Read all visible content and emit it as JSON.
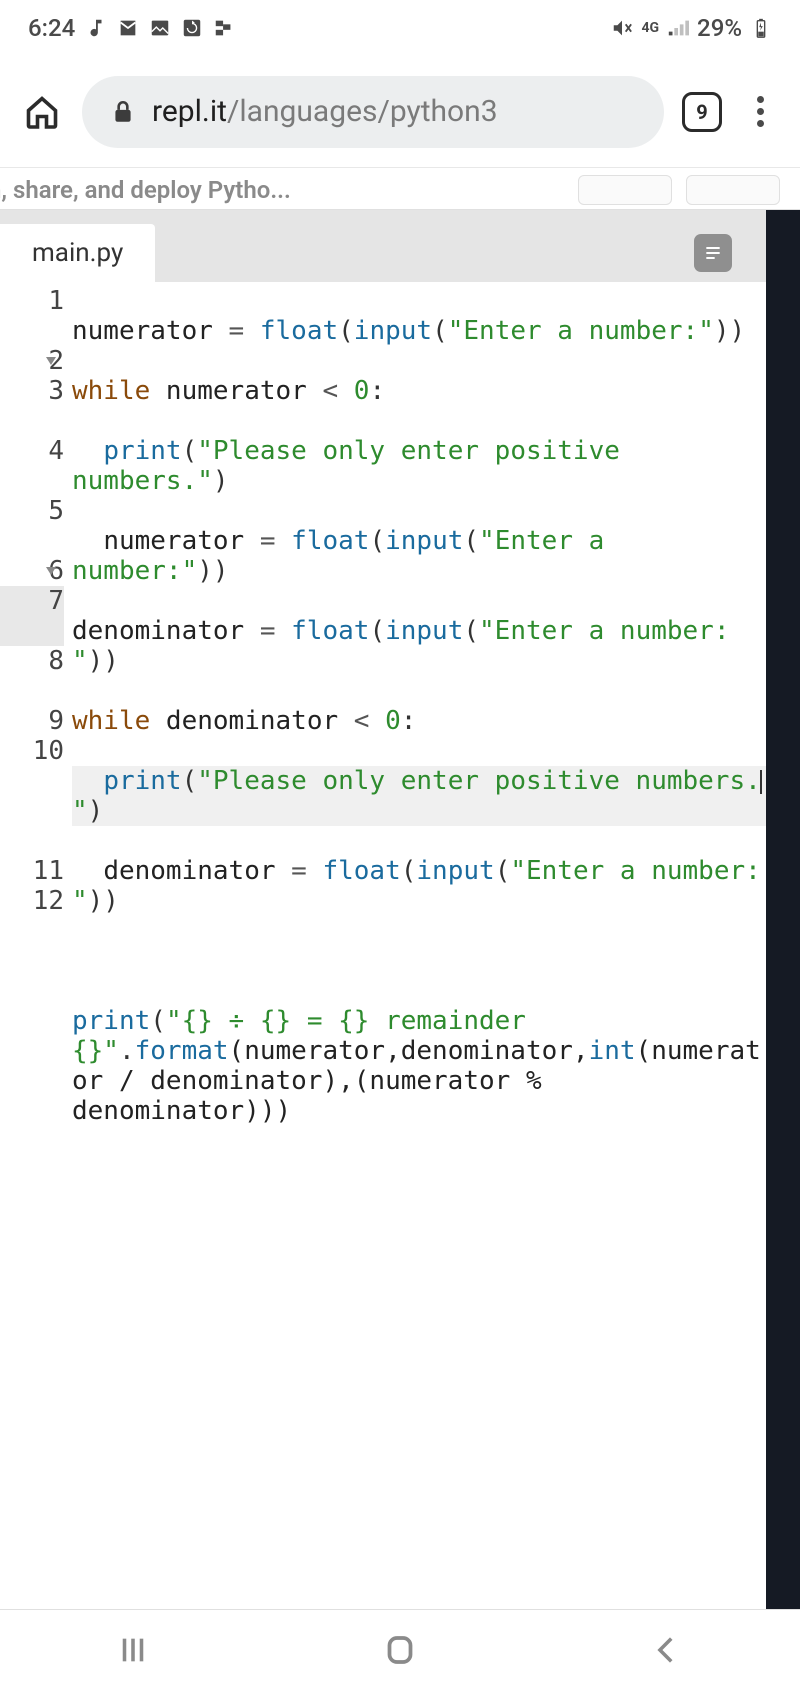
{
  "status": {
    "time": "6:24",
    "network_label": "4G",
    "battery_percent": "29%"
  },
  "browser": {
    "url_domain": "repl.it",
    "url_path": "/languages/python3",
    "tab_count": "9"
  },
  "banner": {
    "truncated_text": "n, share, and deploy Pytho..."
  },
  "editor": {
    "filename": "main.py",
    "line_numbers": [
      "1",
      "2",
      "3",
      "4",
      "5",
      "6",
      "7",
      "8",
      "9",
      "10",
      "11",
      "12"
    ],
    "highlighted_line": 7,
    "fold_lines": [
      2,
      6
    ],
    "code": {
      "l1": {
        "a": "numerator ",
        "b": "=",
        "c": " ",
        "d": "float",
        "e": "(",
        "f": "input",
        "g": "(",
        "h": "\"Enter a number:\"",
        "i": "))"
      },
      "l2": {
        "a": "while",
        "b": " numerator ",
        "c": "<",
        "d": " ",
        "e": "0",
        "f": ":"
      },
      "l3": {
        "a": "  ",
        "b": "print",
        "c": "(",
        "d": "\"Please only enter positive numbers.\"",
        "e": ")"
      },
      "l4": {
        "a": "  numerator ",
        "b": "=",
        "c": " ",
        "d": "float",
        "e": "(",
        "f": "input",
        "g": "(",
        "h": "\"Enter a number:\"",
        "i": "))"
      },
      "l5": {
        "a": "denominator ",
        "b": "=",
        "c": " ",
        "d": "float",
        "e": "(",
        "f": "input",
        "g": "(",
        "h": "\"Enter a number: \"",
        "i": "))"
      },
      "l6": {
        "a": "while",
        "b": " denominator ",
        "c": "<",
        "d": " ",
        "e": "0",
        "f": ":"
      },
      "l7": {
        "a": "  ",
        "b": "print",
        "c": "(",
        "d": "\"Please only enter positive numbers.",
        "e": "\"",
        "f": ")"
      },
      "l8": {
        "a": "  denominator ",
        "b": "=",
        "c": " ",
        "d": "float",
        "e": "(",
        "f": "input",
        "g": "(",
        "h": "\"Enter a number: \"",
        "i": "))"
      },
      "l9": "",
      "l10": {
        "a": "print",
        "b": "(",
        "c": "\"{} ÷ {} = {} remainder {}\"",
        "d": ".",
        "e": "format",
        "f": "(numerator,denominator,",
        "g": "int",
        "h": "(numerator / denominator),(numerator % denominator)))"
      },
      "l11": "",
      "l12": ""
    }
  },
  "icons": {
    "music": "music-note-icon",
    "mail": "mail-icon",
    "image": "image-icon",
    "refresh": "refresh-icon",
    "flag": "flag-icon",
    "mute": "mute-icon",
    "signal": "signal-icon",
    "battery": "battery-icon",
    "home": "home-icon",
    "lock": "lock-icon",
    "more": "more-vertical-icon",
    "wrap": "wrap-icon",
    "recents": "recents-icon",
    "nav_home": "nav-home-icon",
    "back": "back-icon"
  }
}
